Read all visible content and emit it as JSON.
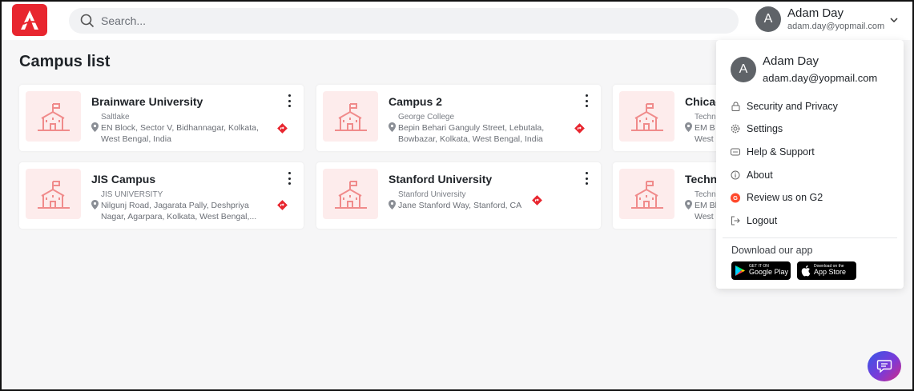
{
  "search": {
    "placeholder": "Search..."
  },
  "user": {
    "initial": "A",
    "name": "Adam Day",
    "email": "adam.day@yopmail.com"
  },
  "page": {
    "title": "Campus list"
  },
  "cards": [
    {
      "name": "Brainware University",
      "sub": "Saltlake",
      "address": "EN Block, Sector V, Bidhannagar, Kolkata, West Bengal, India"
    },
    {
      "name": "Campus 2",
      "sub": "George College",
      "address": "Bepin Behari Ganguly Street, Lebutala, Bowbazar, Kolkata, West Bengal, India"
    },
    {
      "name": "Chicag",
      "sub": "Techn",
      "address": "EM B\nWest"
    },
    {
      "name": "JIS Campus",
      "sub": "JIS UNIVERSITY",
      "address": "Nilgunj Road, Jagarata Pally, Deshpriya Nagar, Agarpara, Kolkata, West Bengal,..."
    },
    {
      "name": "Stanford University",
      "sub": "Stanford University",
      "address": "Jane Stanford Way, Stanford, CA"
    },
    {
      "name": "Techn",
      "sub": "Techn",
      "address": "EM Bl\nWest"
    }
  ],
  "dropdown": {
    "items": [
      {
        "label": "Security and Privacy",
        "icon": "lock-icon"
      },
      {
        "label": "Settings",
        "icon": "gear-icon"
      },
      {
        "label": "Help & Support",
        "icon": "support-icon"
      },
      {
        "label": "About",
        "icon": "info-icon"
      },
      {
        "label": "Review us on G2",
        "icon": "g2-icon"
      },
      {
        "label": "Logout",
        "icon": "logout-icon"
      }
    ],
    "download_label": "Download our app",
    "google_play": {
      "top": "GET IT ON",
      "bottom": "Google Play"
    },
    "app_store": {
      "top": "Download on the",
      "bottom": "App Store"
    }
  },
  "colors": {
    "brand": "#e8262f",
    "thumb_bg": "#fdecec",
    "building": "#f08b8b",
    "g2": "#ff492c"
  }
}
